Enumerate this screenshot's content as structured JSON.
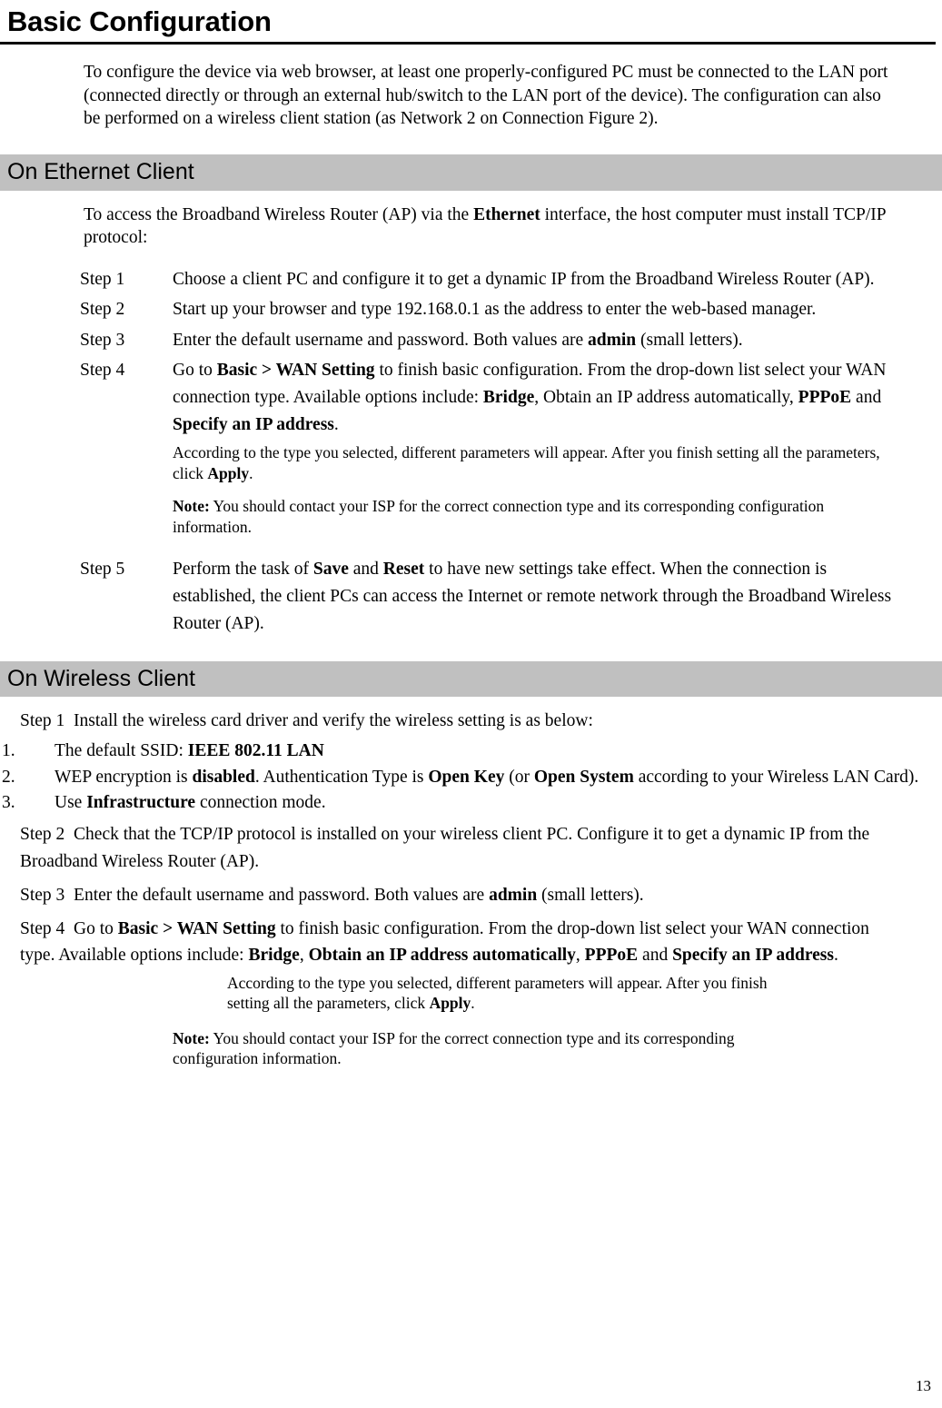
{
  "title": "Basic Configuration",
  "intro": "To configure the device via web browser, at least one properly-configured PC must be connected to the LAN port (connected directly or through an external hub/switch to the LAN port of the device). The configuration can also be performed on a wireless client station (as Network 2 on Connection Figure 2).",
  "ethernet": {
    "heading": "On Ethernet Client",
    "lead_a": "To access the Broadband Wireless Router (AP) via the ",
    "lead_b": "Ethernet",
    "lead_c": " interface, the host computer must install TCP/IP protocol:",
    "steps": [
      {
        "label": "Step 1",
        "text": "Choose a client PC and configure it to get a dynamic IP from the Broadband Wireless Router (AP)."
      },
      {
        "label": "Step 2",
        "text": "Start up your browser and type 192.168.0.1 as the address to enter the web-based manager."
      },
      {
        "label": "Step 3",
        "text_a": "Enter the default username and password. Both values are ",
        "bold_1": "admin",
        "text_b": " (small letters)."
      },
      {
        "label": "Step 4",
        "t1": "Go to ",
        "b1": "Basic > WAN Setting",
        "t2": " to finish basic configuration. From the drop-down list select your WAN connection type. Available options include: ",
        "b2": "Bridge",
        "t3": ", Obtain an IP address automatically, ",
        "b3": "PPPoE",
        "t4": " and ",
        "b4": "Specify an IP address",
        "t5": ".",
        "sub_a": "According to the type you selected, different parameters will appear. After you finish setting all the parameters, click ",
        "sub_b": "Apply",
        "sub_c": ".",
        "note_label": "Note:",
        "note_text": " You should contact your ISP for the correct connection type and its corresponding configuration information."
      },
      {
        "label": "Step 5",
        "t1": "Perform the task of ",
        "b1": "Save",
        "t2": " and ",
        "b2": "Reset",
        "t3": " to have new settings take effect. When the connection is established, the client PCs can access the Internet or remote network through the Broadband Wireless Router (AP)."
      }
    ]
  },
  "wireless": {
    "heading": "On Wireless Client",
    "step1_label": "Step 1",
    "step1_text": "Install the wireless card driver and verify the wireless setting is as below:",
    "list": [
      {
        "num": "1.",
        "t1": "The default SSID: ",
        "b1": "IEEE 802.11 LAN",
        "t2": ""
      },
      {
        "num": "2.",
        "t1": "WEP encryption is ",
        "b1": "disabled",
        "t2": ". Authentication Type is ",
        "b2": "Open Key",
        "t3": " (or ",
        "b3": "Open System",
        "t4": " according to your Wireless LAN Card)."
      },
      {
        "num": "3.",
        "t1": "Use ",
        "b1": "Infrastructure",
        "t2": " connection mode."
      }
    ],
    "step2_label": "Step 2",
    "step2_text": "Check that the TCP/IP protocol is installed on your wireless client PC. Configure it to get a dynamic IP from the Broadband Wireless Router (AP).",
    "step3_label": "Step 3",
    "step3_a": "Enter the default username and password. Both values are ",
    "step3_b": "admin",
    "step3_c": " (small letters).",
    "step4_label": "Step 4",
    "step4": {
      "t1": "Go to ",
      "b1": "Basic > WAN Setting",
      "t2": " to finish basic configuration. From the drop-down list select your WAN connection type. Available options include: ",
      "b2": "Bridge",
      "t3": ", ",
      "b3": "Obtain an IP address automatically",
      "t4": ", ",
      "b4": "PPPoE",
      "t5": " and ",
      "b5": "Specify an IP address",
      "t6": ".",
      "sub_a": "According to the type you selected, different parameters will appear. After you finish setting all the parameters, click ",
      "sub_b": "Apply",
      "sub_c": ".",
      "note_label": "Note:",
      "note_text": " You should contact your ISP for the correct connection type and its corresponding configuration information."
    }
  },
  "page_number": "13"
}
